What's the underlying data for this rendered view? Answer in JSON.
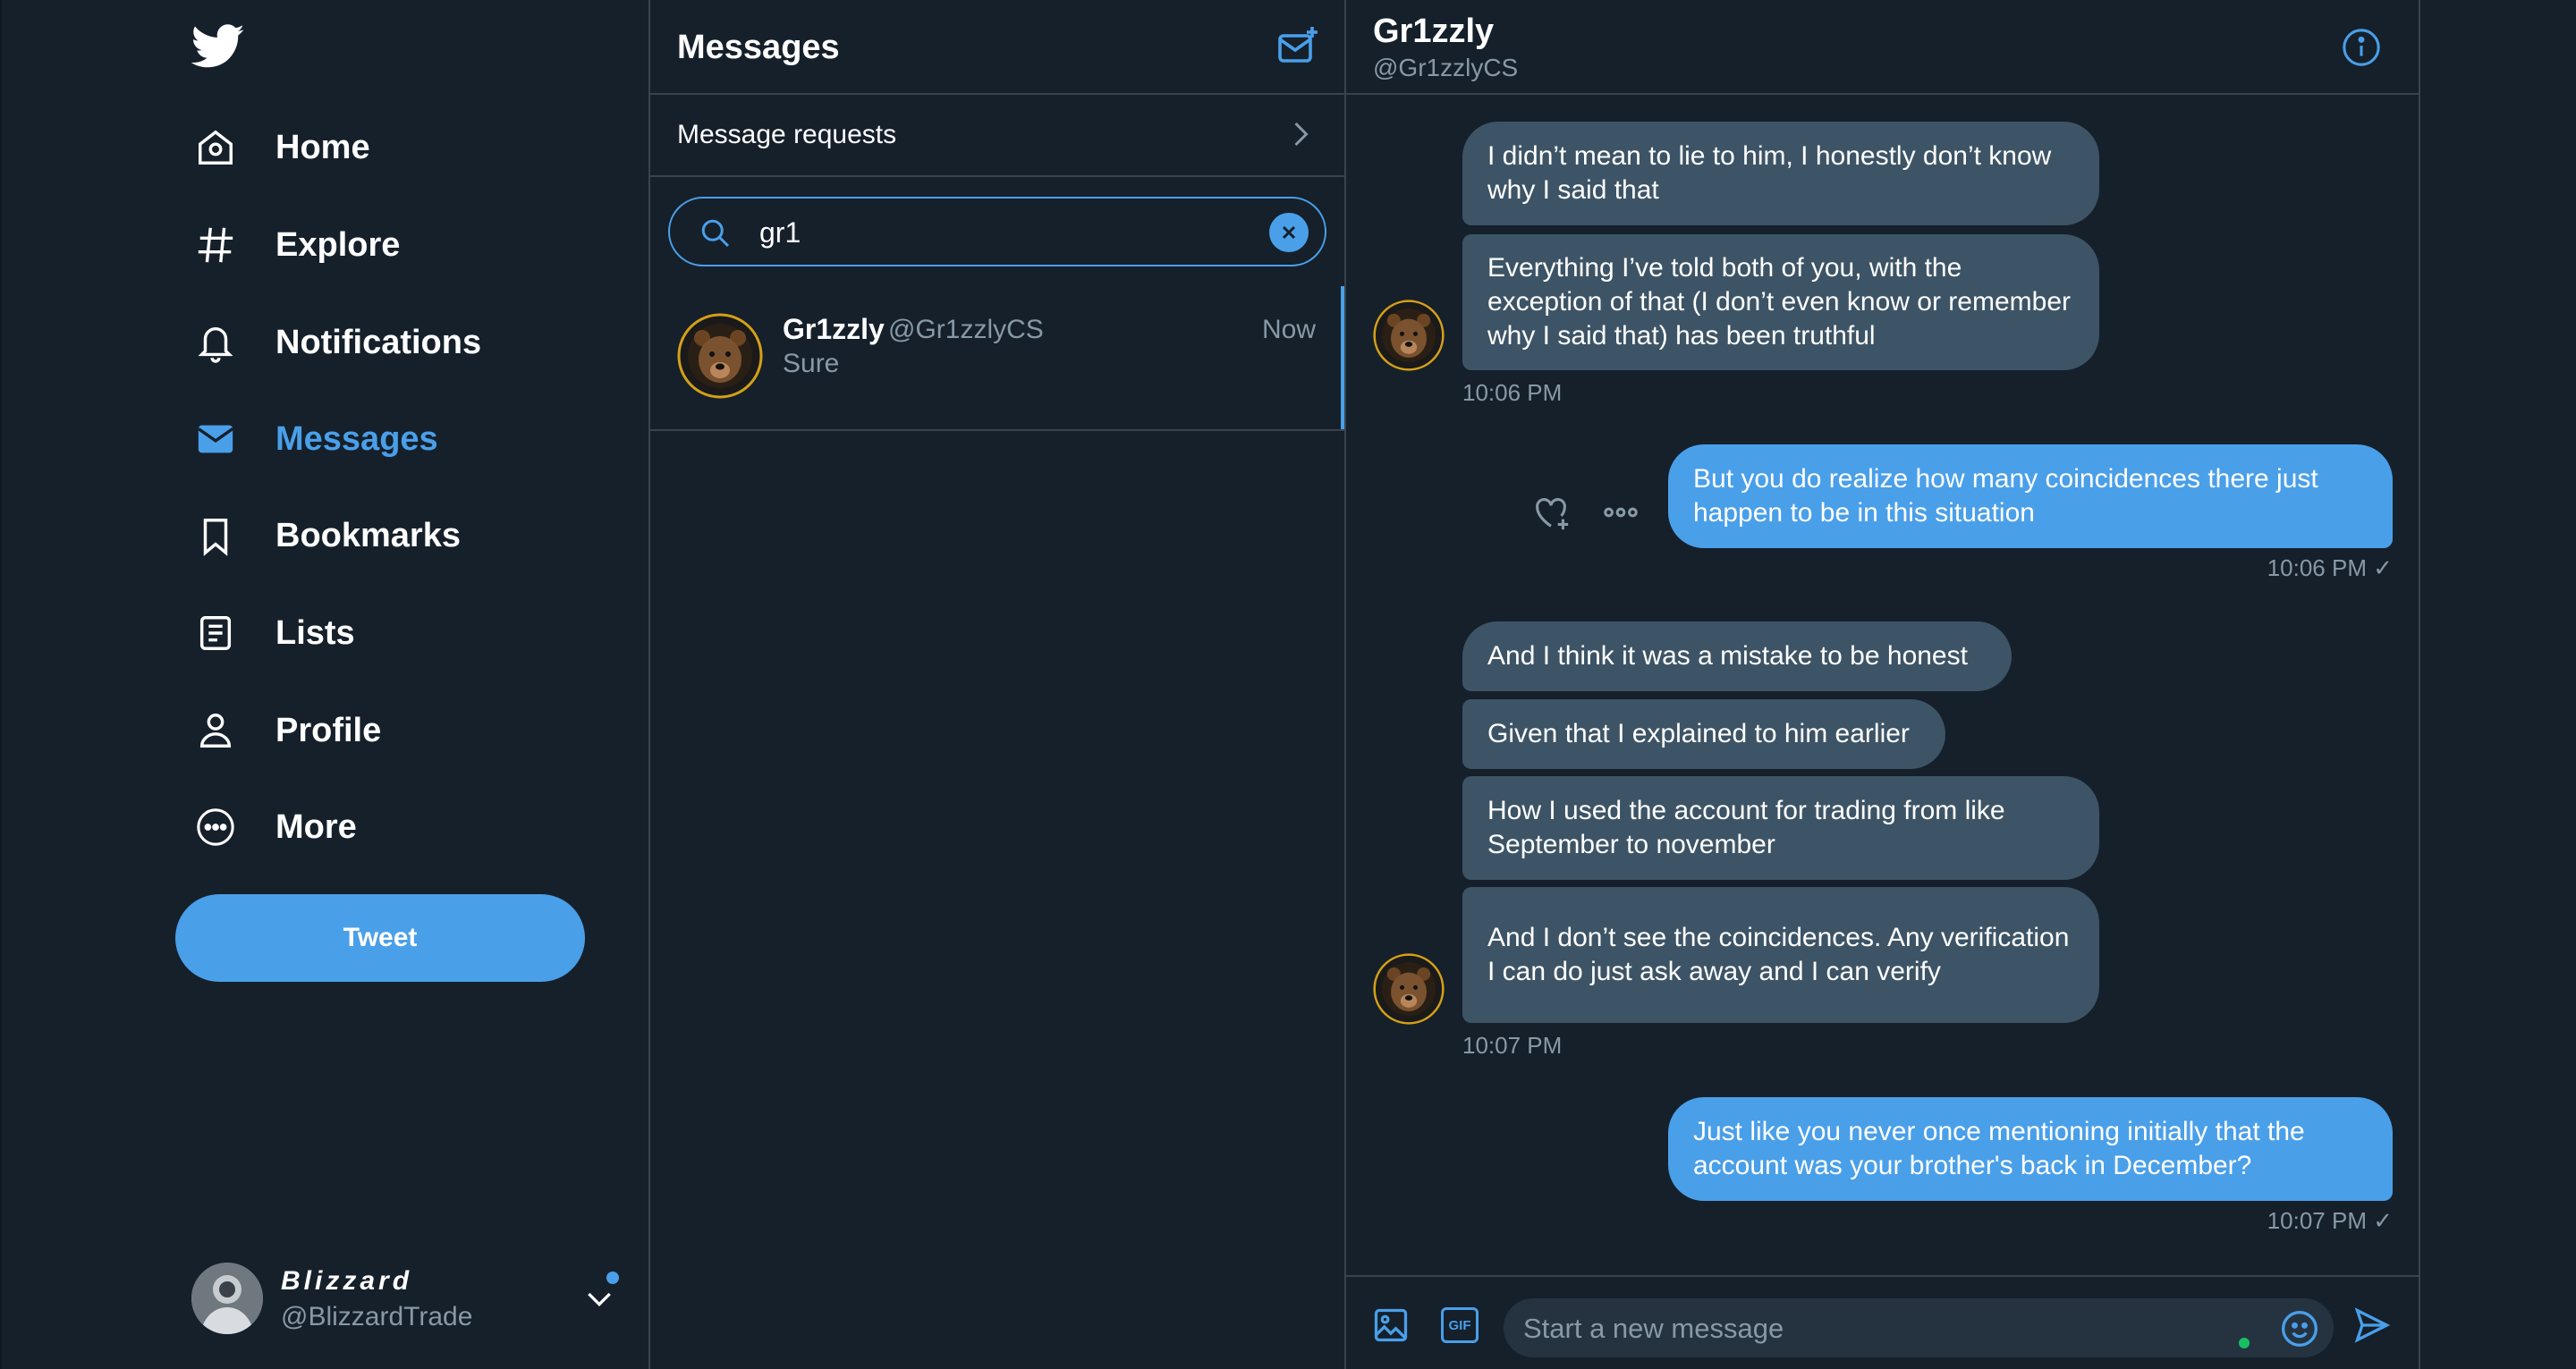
{
  "nav": {
    "items": [
      {
        "label": "Home",
        "icon": "home-icon"
      },
      {
        "label": "Explore",
        "icon": "hashtag-icon"
      },
      {
        "label": "Notifications",
        "icon": "bell-icon"
      },
      {
        "label": "Messages",
        "icon": "envelope-icon"
      },
      {
        "label": "Bookmarks",
        "icon": "bookmark-icon"
      },
      {
        "label": "Lists",
        "icon": "list-icon"
      },
      {
        "label": "Profile",
        "icon": "person-icon"
      },
      {
        "label": "More",
        "icon": "more-circle-icon"
      }
    ],
    "tweet_label": "Tweet",
    "account": {
      "name": "Blizzard",
      "handle": "@BlizzardTrade"
    }
  },
  "messages_panel": {
    "title": "Messages",
    "requests_label": "Message requests",
    "search_value": "gr1",
    "conversation": {
      "name": "Gr1zzly",
      "handle": "@Gr1zzlyCS",
      "time": "Now",
      "preview": "Sure"
    }
  },
  "chat": {
    "name": "Gr1zzly",
    "handle": "@Gr1zzlyCS",
    "messages": [
      {
        "text": "I didn’t mean to lie to him, I honestly don’t know why I said that"
      },
      {
        "text": "Everything I’ve told both of you, with the exception of that (I don’t even know or remember why I said that) has been truthful"
      },
      {
        "time": "10:06 PM"
      },
      {
        "text": "But you do realize how many coincidences there just happen to be in this situation"
      },
      {
        "time": "10:06 PM ✓"
      },
      {
        "text": "And I think it was a mistake to be honest"
      },
      {
        "text": "Given that I explained to him earlier"
      },
      {
        "text": "How I used the account for trading from like September to november"
      },
      {
        "text": "And I don’t see the coincidences. Any verification I can do just ask away and I can verify"
      },
      {
        "time": "10:07 PM"
      },
      {
        "text": "Just like you never once mentioning initially that the account was your brother's back in December?"
      },
      {
        "time": "10:07 PM ✓"
      }
    ],
    "composer": {
      "placeholder": "Start a new message",
      "gif_label": "GIF"
    }
  },
  "colors": {
    "background": "#15202b",
    "accent": "#4a9fe9",
    "incoming_bubble": "#3d5466",
    "muted_text": "#8899a6",
    "border": "#38444d"
  }
}
